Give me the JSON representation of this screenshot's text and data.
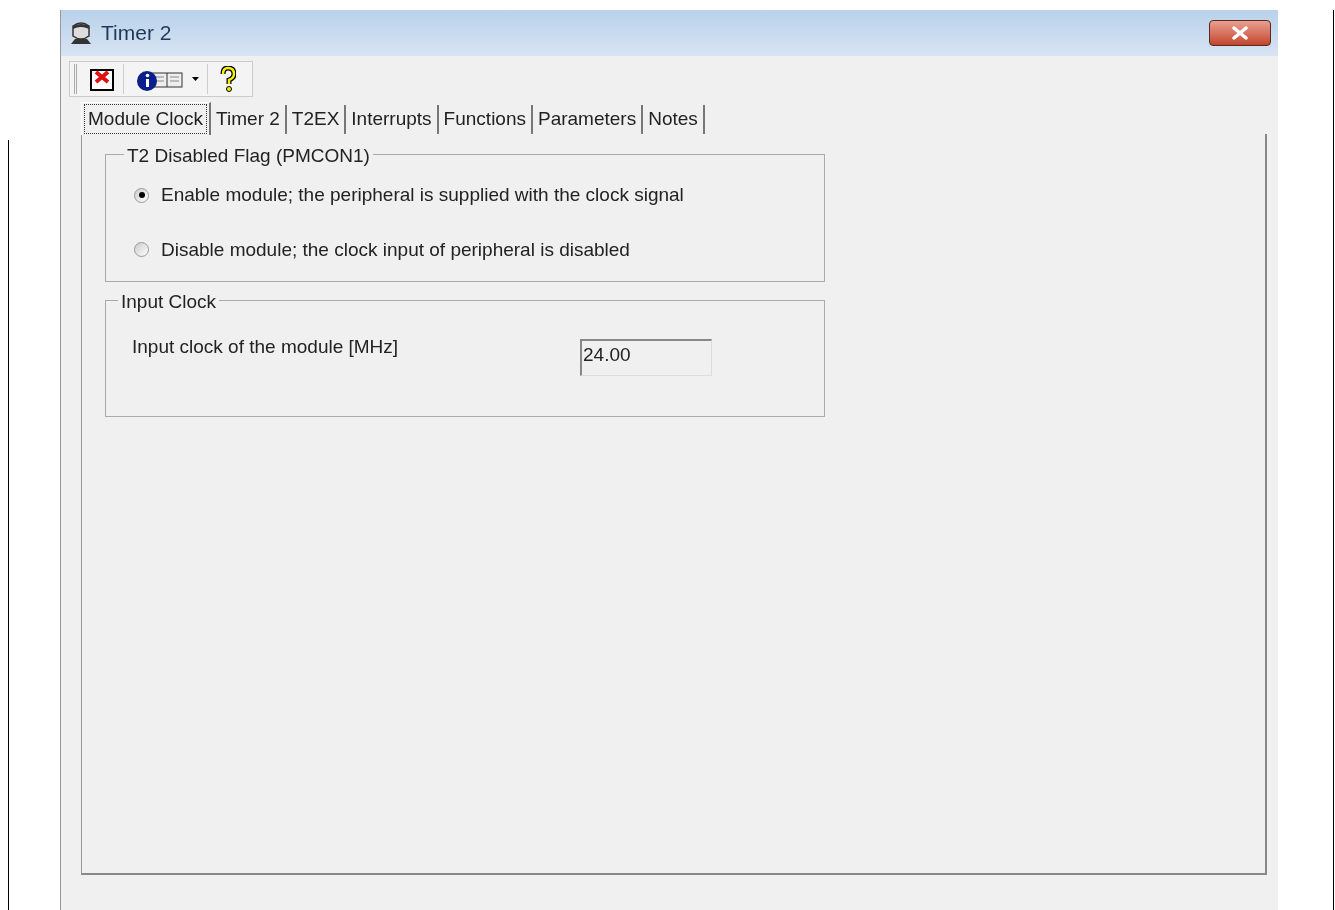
{
  "window": {
    "title": "Timer 2"
  },
  "toolbar": {
    "items": [
      {
        "kind": "close-doc"
      },
      {
        "kind": "info-dropdown"
      },
      {
        "kind": "help"
      }
    ]
  },
  "tabs": [
    {
      "label": "Module Clock",
      "selected": true
    },
    {
      "label": "Timer 2",
      "selected": false
    },
    {
      "label": "T2EX",
      "selected": false
    },
    {
      "label": "Interrupts",
      "selected": false
    },
    {
      "label": "Functions",
      "selected": false
    },
    {
      "label": "Parameters",
      "selected": false
    },
    {
      "label": "Notes",
      "selected": false
    }
  ],
  "groups": [
    {
      "title": "T2 Disabled Flag (PMCON1)",
      "kind": "radio",
      "options": [
        {
          "label": "Enable module; the peripheral is supplied with the clock signal",
          "selected": true
        },
        {
          "label": "Disable module; the clock input of peripheral is disabled",
          "selected": false
        }
      ]
    },
    {
      "title": "Input Clock",
      "kind": "field",
      "label": "Input clock of the module [MHz]",
      "value": "24.00"
    }
  ]
}
